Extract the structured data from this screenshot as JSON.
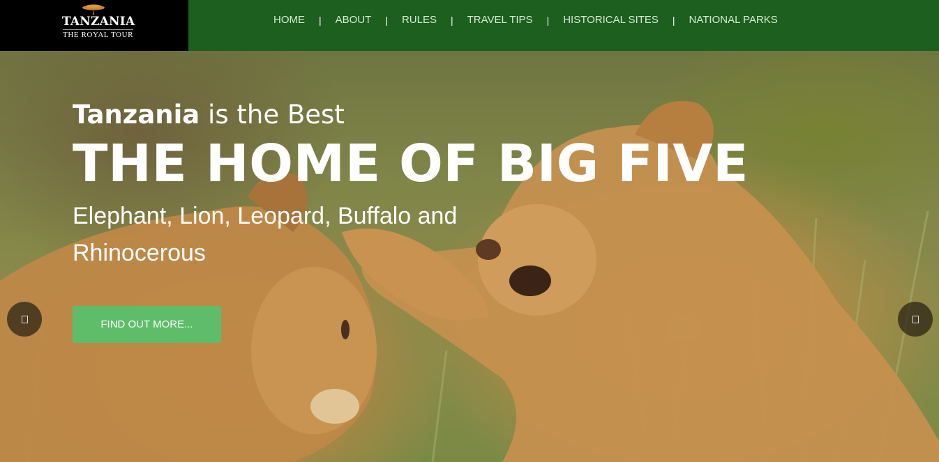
{
  "logo": {
    "title": "TANZANIA",
    "subtitle": "THE ROYAL TOUR",
    "icon": "acacia-tree-icon"
  },
  "nav": {
    "items": [
      {
        "label": "HOME"
      },
      {
        "label": "ABOUT"
      },
      {
        "label": "RULES"
      },
      {
        "label": "TRAVEL TIPS"
      },
      {
        "label": "HISTORICAL SITES"
      },
      {
        "label": "NATIONAL PARKS"
      }
    ],
    "separator": "|"
  },
  "hero": {
    "eyebrow_bold": "Tanzania",
    "eyebrow_rest": " is the Best",
    "headline": "THE HOME OF BIG FIVE",
    "tagline": "Elephant, Lion, Leopard, Buffalo and Rhinocerous",
    "cta_label": "FIND OUT MORE...",
    "prev_icon": "chevron-left-icon",
    "next_icon": "chevron-right-icon"
  },
  "colors": {
    "header_bg": "#1c5f1f",
    "logo_bg": "#000000",
    "cta_bg": "#5fbd6a",
    "nav_text": "#d9ead4"
  }
}
